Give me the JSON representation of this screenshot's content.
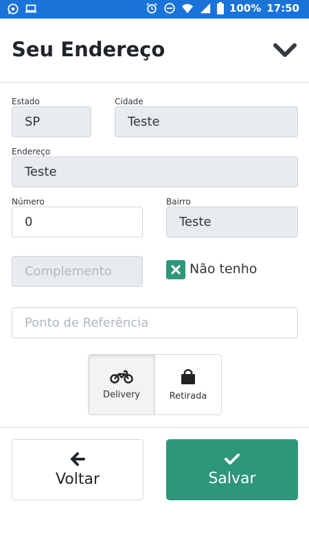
{
  "status_bar": {
    "battery": "100%",
    "time": "17:50",
    "icons": [
      "whatsapp-icon",
      "laptop-icon",
      "alarm-icon",
      "dnd-icon",
      "wifi-icon",
      "signal-icon",
      "battery-icon"
    ]
  },
  "header": {
    "title": "Seu Endereço",
    "collapse_icon": "chevron-down-icon"
  },
  "form": {
    "estado": {
      "label": "Estado",
      "value": "SP"
    },
    "cidade": {
      "label": "Cidade",
      "value": "Teste"
    },
    "endereco": {
      "label": "Endereço",
      "value": "Teste"
    },
    "numero": {
      "label": "Número",
      "value": "0"
    },
    "bairro": {
      "label": "Bairro",
      "value": "Teste"
    },
    "complemento": {
      "placeholder": "Complemento"
    },
    "nao_tenho": {
      "label": "Não tenho",
      "checked": true
    },
    "referencia": {
      "placeholder": "Ponto de Referência"
    }
  },
  "delivery_mode": {
    "options": [
      {
        "label": "Delivery",
        "icon": "motorcycle-icon",
        "selected": true
      },
      {
        "label": "Retirada",
        "icon": "shopping-bag-icon",
        "selected": false
      }
    ]
  },
  "actions": {
    "back_label": "Voltar",
    "save_label": "Salvar"
  },
  "colors": {
    "status_bar": "#1a73d9",
    "accent": "#2e977a",
    "readonly_field": "#e9ecef"
  }
}
